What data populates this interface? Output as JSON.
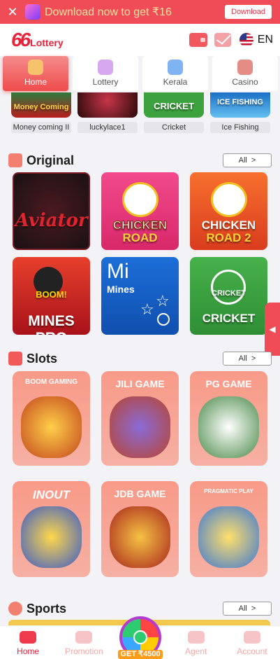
{
  "download_bar": {
    "close_glyph": "✕",
    "app_icon_text": "66Lottery",
    "message": "Download now to get ₹16",
    "button_label": "Download"
  },
  "header": {
    "logo_number": "66",
    "logo_text": "Lottery",
    "language": "EN"
  },
  "categories": [
    {
      "label": "Home",
      "active": true
    },
    {
      "label": "Lottery",
      "active": false
    },
    {
      "label": "Kerala",
      "active": false
    },
    {
      "label": "Casino",
      "active": false
    }
  ],
  "recent_games": [
    {
      "label": "Money coming II",
      "art_text": "Money Coming"
    },
    {
      "label": "luckylace1",
      "art_text": ""
    },
    {
      "label": "Cricket",
      "art_text": "CRICKET"
    },
    {
      "label": "Ice Fishing",
      "art_text": "ICE FISHING"
    }
  ],
  "sections": {
    "original": {
      "title": "Original",
      "all_label": "All",
      "chevron": ">"
    },
    "slots": {
      "title": "Slots",
      "all_label": "All",
      "chevron": ">"
    },
    "sports": {
      "title": "Sports",
      "all_label": "All",
      "chevron": ">"
    }
  },
  "original_games": [
    {
      "name": "Aviator",
      "line2": ""
    },
    {
      "name": "CHICKEN",
      "line2": "ROAD"
    },
    {
      "name": "CHICKEN",
      "line2": "ROAD 2"
    },
    {
      "name": "MINES PRO",
      "badge": "BOOM!"
    },
    {
      "name": "Mi",
      "line2": "Mines"
    },
    {
      "name": "CRICKET",
      "badge": "CRICKET"
    }
  ],
  "slot_providers": [
    {
      "brand": "BOOM GAMING"
    },
    {
      "brand": "JILI GAME"
    },
    {
      "brand": "PG GAME"
    },
    {
      "brand": "INOUT"
    },
    {
      "brand": "JDB GAME"
    },
    {
      "brand": "PRAGMATIC PLAY"
    }
  ],
  "side_tab": {
    "glyph": "◀"
  },
  "bottom_nav": [
    {
      "label": "Home",
      "active": true
    },
    {
      "label": "Promotion",
      "active": false
    },
    {
      "label": "",
      "active": false
    },
    {
      "label": "Agent",
      "active": false
    },
    {
      "label": "Account",
      "active": false
    }
  ],
  "wheel": {
    "label": "GET ₹4500"
  }
}
